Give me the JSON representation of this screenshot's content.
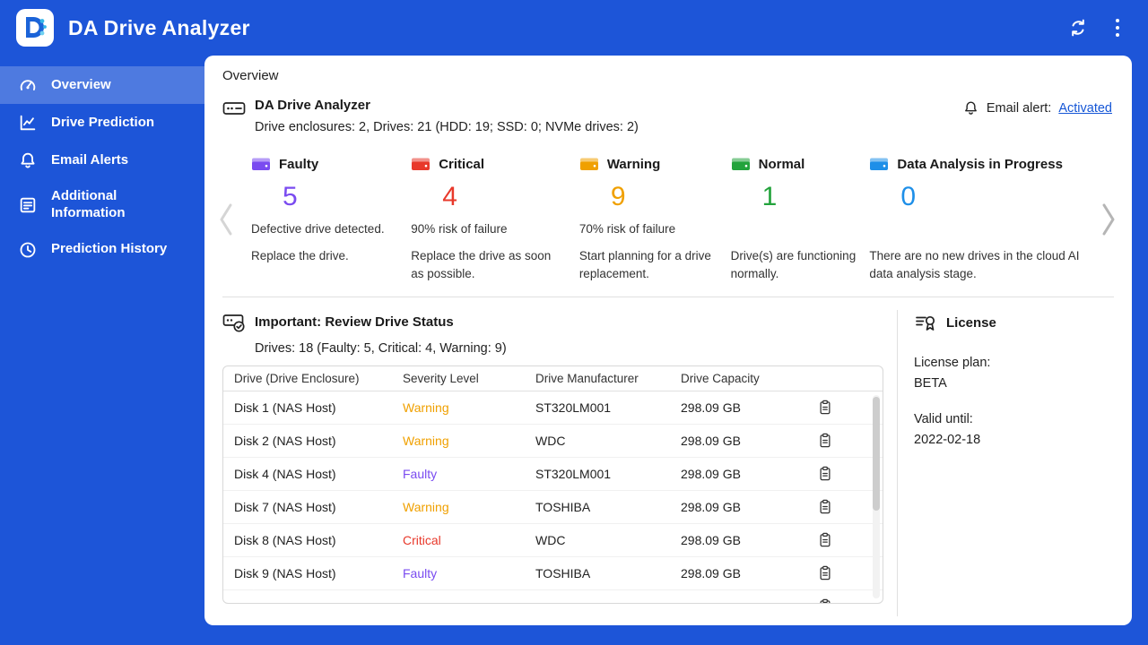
{
  "colors": {
    "primary_blue": "#1d55d8",
    "active_item_bg": "rgba(255,255,255,0.22)",
    "link_blue": "#1556d6",
    "faulty_purple": "#7a4bf0",
    "critical_red": "#e8392b",
    "warning_orange": "#f0a000",
    "normal_green": "#23a33c",
    "analysis_blue": "#1e8fe8"
  },
  "icons": {
    "app-logo-icon": "stylized-D-with-dots",
    "refresh-icon": "circular-sync-arrows",
    "menu-kebab-icon": "vertical-three-dots",
    "gauge-icon": "speedometer",
    "line-chart-icon": "line-chart",
    "bell-icon": "bell",
    "document-icon": "document-with-lines",
    "clock-icon": "clock",
    "drive-icon": "drive-enclosure-outline",
    "drive-check-icon": "drive-with-checkmark",
    "license-icon": "certificate-seal",
    "clipboard-icon": "clipboard",
    "chevron-left-icon": "‹",
    "chevron-right-icon": "›"
  },
  "header": {
    "app_title": "DA Drive Analyzer"
  },
  "sidebar": {
    "items": [
      {
        "label": "Overview",
        "icon": "gauge-icon",
        "active": true
      },
      {
        "label": "Drive Prediction",
        "icon": "line-chart-icon",
        "active": false
      },
      {
        "label": "Email Alerts",
        "icon": "bell-icon",
        "active": false
      },
      {
        "label": "Additional Information",
        "icon": "document-icon",
        "active": false
      },
      {
        "label": "Prediction History",
        "icon": "clock-icon",
        "active": false
      }
    ]
  },
  "main": {
    "page_title": "Overview",
    "summary": {
      "title": "DA Drive Analyzer",
      "subtitle": "Drive enclosures: 2, Drives: 21 (HDD: 19; SSD: 0; NVMe drives: 2)",
      "email_alert_label": "Email alert:",
      "email_alert_link": "Activated"
    },
    "status_cards": [
      {
        "label": "Faulty",
        "value": "5",
        "color": "#7a4bf0",
        "desc1": "Defective drive detected.",
        "desc2": "Replace the drive."
      },
      {
        "label": "Critical",
        "value": "4",
        "color": "#e8392b",
        "desc1": "90% risk of failure",
        "desc2": "Replace the drive as soon as possible."
      },
      {
        "label": "Warning",
        "value": "9",
        "color": "#f0a000",
        "desc1": "70% risk of failure",
        "desc2": "Start planning for a drive replacement."
      },
      {
        "label": "Normal",
        "value": "1",
        "color": "#23a33c",
        "desc1": "",
        "desc2": "Drive(s) are functioning normally."
      },
      {
        "label": "Data Analysis in Progress",
        "value": "0",
        "color": "#1e8fe8",
        "desc1": "",
        "desc2": "There are no new drives in the cloud AI data analysis stage."
      }
    ],
    "review": {
      "title": "Important: Review Drive Status",
      "subtitle": "Drives: 18 (Faulty: 5, Critical: 4, Warning: 9)",
      "table": {
        "headers": [
          "Drive (Drive Enclosure)",
          "Severity Level",
          "Drive Manufacturer",
          "Drive Capacity"
        ],
        "severity_colors": {
          "Warning": "#f0a000",
          "Faulty": "#7a4bf0",
          "Critical": "#e8392b"
        },
        "rows": [
          {
            "drive": "Disk 1 (NAS Host)",
            "severity": "Warning",
            "manufacturer": "ST320LM001",
            "capacity": "298.09 GB"
          },
          {
            "drive": "Disk 2 (NAS Host)",
            "severity": "Warning",
            "manufacturer": "WDC",
            "capacity": "298.09 GB"
          },
          {
            "drive": "Disk 4 (NAS Host)",
            "severity": "Faulty",
            "manufacturer": "ST320LM001",
            "capacity": "298.09 GB"
          },
          {
            "drive": "Disk 7 (NAS Host)",
            "severity": "Warning",
            "manufacturer": "TOSHIBA",
            "capacity": "298.09 GB"
          },
          {
            "drive": "Disk 8 (NAS Host)",
            "severity": "Critical",
            "manufacturer": "WDC",
            "capacity": "298.09 GB"
          },
          {
            "drive": "Disk 9 (NAS Host)",
            "severity": "Faulty",
            "manufacturer": "TOSHIBA",
            "capacity": "298.09 GB"
          },
          {
            "drive": "",
            "severity": "",
            "manufacturer": "",
            "capacity": ""
          }
        ]
      }
    },
    "license": {
      "title": "License",
      "plan_label": "License plan:",
      "plan_value": "BETA",
      "valid_label": "Valid until:",
      "valid_value": "2022-02-18"
    }
  }
}
